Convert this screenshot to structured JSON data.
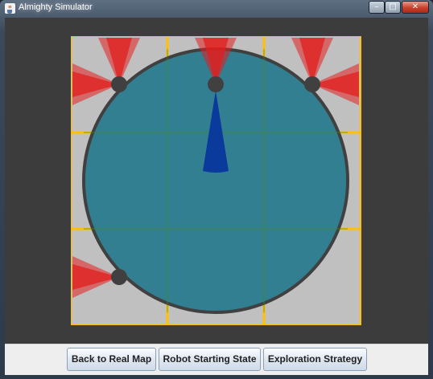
{
  "window": {
    "title": "Almighty Simulator",
    "icon": "java-cup-icon",
    "controls": {
      "minimize": "minimize-icon",
      "maximize": "maximize-icon",
      "close": "close-icon"
    }
  },
  "colors": {
    "client_background": "#3c3c3c",
    "arena_floor": "#c0c0c0",
    "grid_lines": "#ffc000",
    "robot_body": "#297a8e",
    "robot_outline": "#404040",
    "heading_indicator": "#0a3a9c",
    "sensor_cone": "#e31e1e",
    "sensor_node": "#404040"
  },
  "arena": {
    "grid": {
      "rows": 3,
      "cols": 3
    },
    "robot": {
      "heading": "north",
      "sensors": [
        {
          "name": "front-left",
          "directions": [
            "north",
            "west"
          ]
        },
        {
          "name": "front-center",
          "directions": [
            "north"
          ]
        },
        {
          "name": "front-right",
          "directions": [
            "north",
            "east"
          ]
        },
        {
          "name": "rear-left",
          "directions": [
            "west"
          ]
        }
      ]
    }
  },
  "buttons": {
    "back": "Back to Real Map",
    "start": "Robot Starting State",
    "strategy": "Exploration Strategy"
  }
}
